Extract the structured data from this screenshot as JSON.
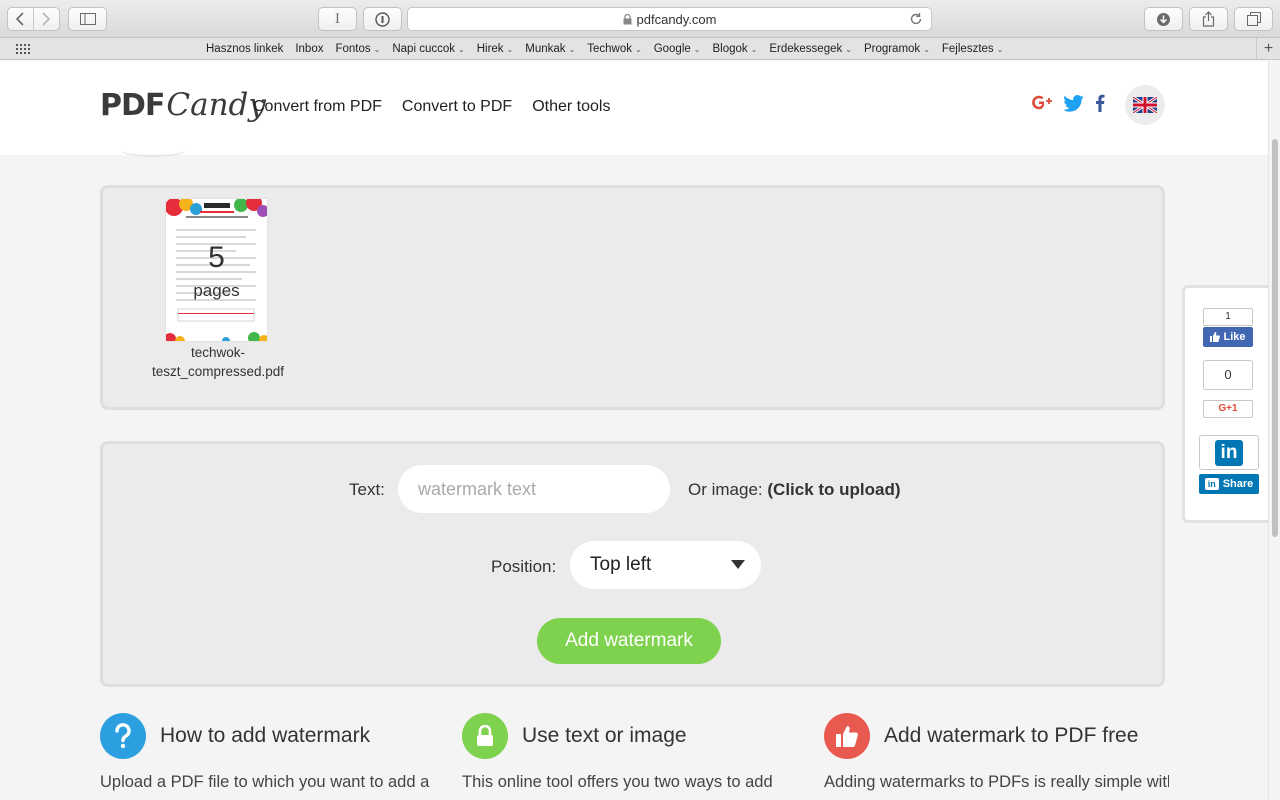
{
  "browser": {
    "url": "pdfcandy.com",
    "bookmarks": [
      {
        "label": "Hasznos linkek",
        "has_menu": false
      },
      {
        "label": "Inbox",
        "has_menu": false
      },
      {
        "label": "Fontos",
        "has_menu": true
      },
      {
        "label": "Napi cuccok",
        "has_menu": true
      },
      {
        "label": "Hirek",
        "has_menu": true
      },
      {
        "label": "Munkak",
        "has_menu": true
      },
      {
        "label": "Techwok",
        "has_menu": true
      },
      {
        "label": "Google",
        "has_menu": true
      },
      {
        "label": "Blogok",
        "has_menu": true
      },
      {
        "label": "Erdekessegek",
        "has_menu": true
      },
      {
        "label": "Programok",
        "has_menu": true
      },
      {
        "label": "Fejlesztes",
        "has_menu": true
      }
    ],
    "bookmark_caret": "⌄",
    "reader_label": "I",
    "add_tab_label": "+"
  },
  "header": {
    "logo_pdf": "PDF",
    "logo_candy": "Candy",
    "nav": [
      "Convert from PDF",
      "Convert to PDF",
      "Other tools"
    ]
  },
  "file": {
    "page_count": "5",
    "pages_label": "pages",
    "name_line1": "techwok-",
    "name_line2": "teszt_compressed.pdf"
  },
  "form": {
    "text_label": "Text:",
    "text_placeholder": "watermark text",
    "or_image_prefix": "Or image:",
    "or_image_link": "(Click to upload)",
    "position_label": "Position:",
    "position_value": "Top left",
    "submit_label": "Add watermark"
  },
  "share": {
    "fb_count": "1",
    "fb_label": "Like",
    "gplus_count": "0",
    "gplus_label": "G+1",
    "linkedin_logo": "in",
    "linkedin_label": "Share"
  },
  "features": [
    {
      "icon": "question-icon",
      "color": "#2b9fe0",
      "title": "How to add watermark",
      "desc": "Upload a PDF file to which you want to add a"
    },
    {
      "icon": "lock-icon",
      "color": "#7ed24e",
      "title": "Use text or image",
      "desc": "This online tool offers you two ways to add"
    },
    {
      "icon": "thumbs-up-icon",
      "color": "#e85a4f",
      "title": "Add watermark to PDF free",
      "desc": "Adding watermarks to PDFs is really simple with"
    }
  ],
  "colors": {
    "accent_green": "#7ed24e",
    "facebook": "#4267b2",
    "linkedin": "#0077b5",
    "google": "#dd4b39"
  }
}
